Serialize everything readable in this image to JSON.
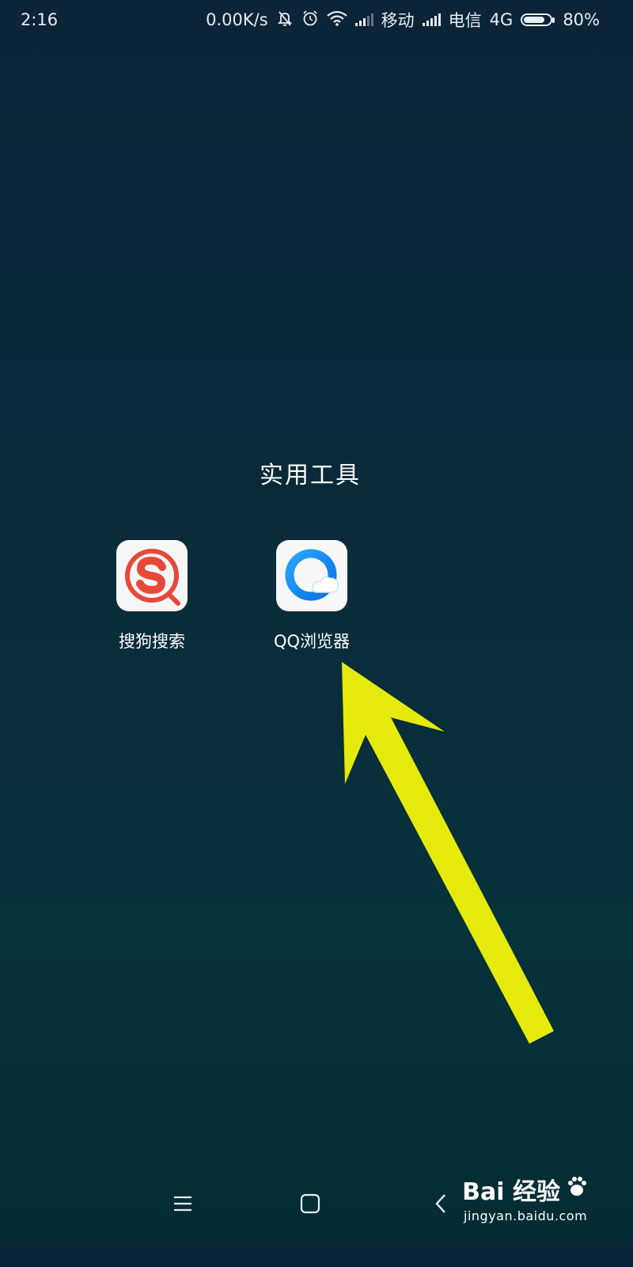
{
  "status_bar": {
    "time": "2:16",
    "net_speed": "0.00K/s",
    "carrier1": "移动",
    "carrier2": "电信",
    "network_type": "4G",
    "battery": "80%",
    "battery_level": 0.8,
    "icons": [
      "mute-bell-icon",
      "alarm-icon",
      "wifi-icon",
      "signal-icon",
      "signal-icon",
      "battery-icon"
    ]
  },
  "folder": {
    "title": "实用工具",
    "apps": [
      {
        "label": "搜狗搜索",
        "icon": "sogou-search-icon",
        "color": "#e8483a"
      },
      {
        "label": "QQ浏览器",
        "icon": "qq-browser-icon",
        "color": "#1e8ff0"
      }
    ]
  },
  "annotation": {
    "arrow_color": "#e6ea0c"
  },
  "nav_bar": {
    "buttons": [
      "menu-icon",
      "home-icon",
      "back-icon"
    ]
  },
  "watermark": {
    "logo_text": "Bai 经验",
    "url": "jingyan.baidu.com"
  }
}
